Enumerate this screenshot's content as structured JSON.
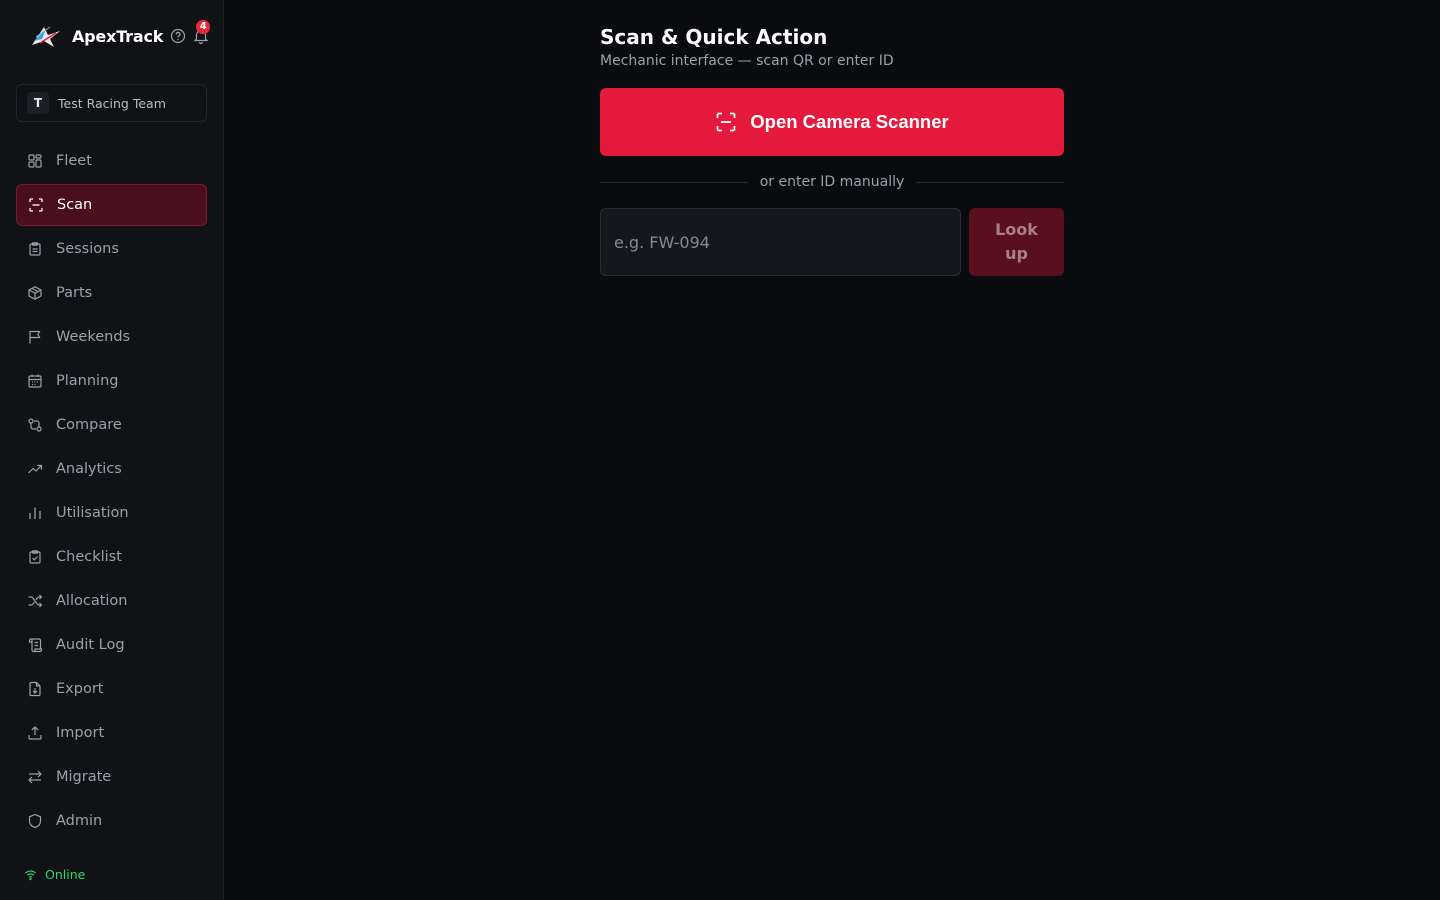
{
  "app": {
    "name": "ApexTrack",
    "notification_count": "4",
    "colors": {
      "accent": "#e5193b",
      "active_bg": "#4a0f1c",
      "online": "#34d36a"
    }
  },
  "team": {
    "initial": "T",
    "name": "Test Racing Team"
  },
  "sidebar": {
    "items": [
      {
        "label": "Fleet",
        "icon": "grid-icon",
        "active": false
      },
      {
        "label": "Scan",
        "icon": "scan-icon",
        "active": true
      },
      {
        "label": "Sessions",
        "icon": "clipboard-icon",
        "active": false
      },
      {
        "label": "Parts",
        "icon": "package-icon",
        "active": false
      },
      {
        "label": "Weekends",
        "icon": "flag-icon",
        "active": false
      },
      {
        "label": "Planning",
        "icon": "calendar-icon",
        "active": false
      },
      {
        "label": "Compare",
        "icon": "compare-icon",
        "active": false
      },
      {
        "label": "Analytics",
        "icon": "trending-up-icon",
        "active": false
      },
      {
        "label": "Utilisation",
        "icon": "bar-chart-icon",
        "active": false
      },
      {
        "label": "Checklist",
        "icon": "clipboard-check-icon",
        "active": false
      },
      {
        "label": "Allocation",
        "icon": "shuffle-icon",
        "active": false
      },
      {
        "label": "Audit Log",
        "icon": "scroll-icon",
        "active": false
      },
      {
        "label": "Export",
        "icon": "file-download-icon",
        "active": false
      },
      {
        "label": "Import",
        "icon": "upload-icon",
        "active": false
      },
      {
        "label": "Migrate",
        "icon": "arrows-swap-icon",
        "active": false
      },
      {
        "label": "Admin",
        "icon": "shield-icon",
        "active": false
      }
    ]
  },
  "status": {
    "label": "Online",
    "icon": "wifi-icon"
  },
  "main": {
    "title": "Scan & Quick Action",
    "subtitle": "Mechanic interface — scan QR or enter ID",
    "scan_button_label": "Open Camera Scanner",
    "divider_label": "or enter ID manually",
    "id_input": {
      "value": "",
      "placeholder": "e.g. FW-094"
    },
    "lookup_label": "Look up"
  }
}
